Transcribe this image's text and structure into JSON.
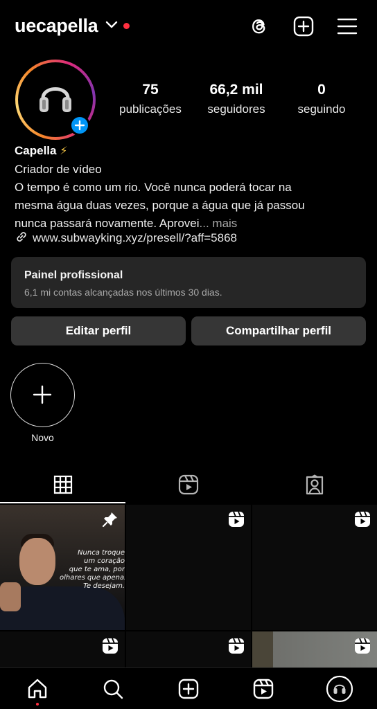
{
  "header": {
    "username": "uecapella",
    "icons": [
      "chevron-down-icon",
      "threads-icon",
      "create-post-icon",
      "menu-icon"
    ],
    "notification_color": "#ff3040"
  },
  "profile": {
    "stats": [
      {
        "value": "75",
        "label": "publicações"
      },
      {
        "value": "66,2 mil",
        "label": "seguidores"
      },
      {
        "value": "0",
        "label": "seguindo"
      }
    ],
    "display_name": "Capella",
    "display_name_emoji": "⚡",
    "category": "Criador de vídeo",
    "bio_line1": "O tempo é como um rio. Você nunca poderá tocar na",
    "bio_line2": "mesma água duas vezes, porque a água que já passou",
    "bio_line3": "nunca passará novamente. Aprovei",
    "bio_more": "... mais",
    "link": "www.subwayking.xyz/presell/?aff=5868"
  },
  "dashboard": {
    "title": "Painel profissional",
    "subtitle": "6,1 mi contas alcançadas nos últimos 30 dias."
  },
  "buttons": {
    "edit": "Editar perfil",
    "share": "Compartilhar perfil"
  },
  "highlight": {
    "new_label": "Novo"
  },
  "tabs": [
    "grid-icon",
    "reels-icon",
    "tagged-icon"
  ],
  "grid": {
    "post1_quote": "Nunca troque\num coração\nque te ama, por\nolhares que apenas\nTe desejam.",
    "post1_badge": "pin-icon",
    "other_badge": "reels-icon"
  },
  "bottom_nav": [
    "home-icon",
    "search-icon",
    "create-icon",
    "reels-icon",
    "profile-avatar"
  ],
  "colors": {
    "accent_blue": "#0095f6",
    "card_bg": "#262626",
    "button_bg": "#363636"
  }
}
